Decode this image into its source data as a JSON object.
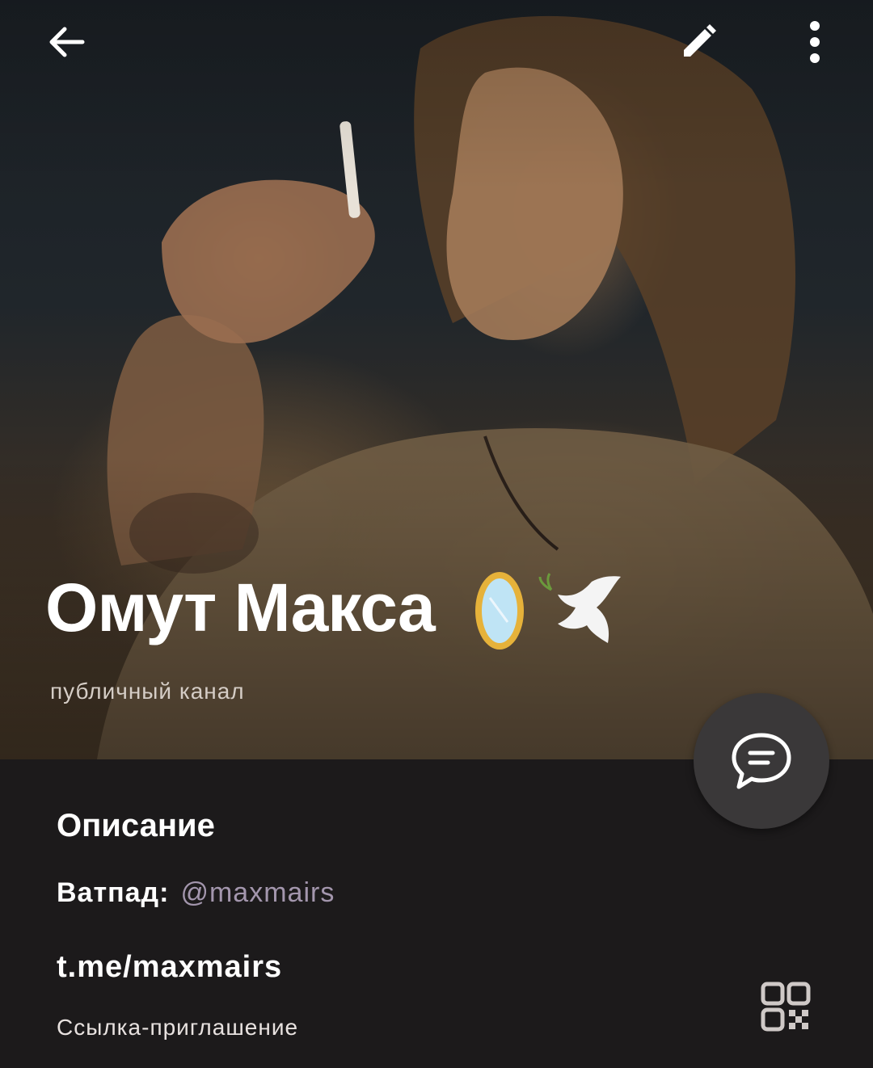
{
  "header": {
    "back_icon": "arrow-left-icon",
    "edit_icon": "pencil-icon",
    "more_icon": "more-vertical-icon"
  },
  "channel": {
    "title": "Омут Макса",
    "title_emojis": [
      "mirror-emoji",
      "dove-emoji"
    ],
    "subtitle": "публичный канал"
  },
  "fab": {
    "icon": "chat-bubble-icon"
  },
  "description": {
    "section_title": "Описание",
    "label": "Ватпад:",
    "handle": "@maxmairs"
  },
  "invite": {
    "link": "t.me/maxmairs",
    "caption": "Ссылка-приглашение",
    "qr_icon": "qr-code-icon"
  },
  "colors": {
    "background": "#1c1a1b",
    "fab": "#3a3839",
    "handle": "#a396ad"
  }
}
